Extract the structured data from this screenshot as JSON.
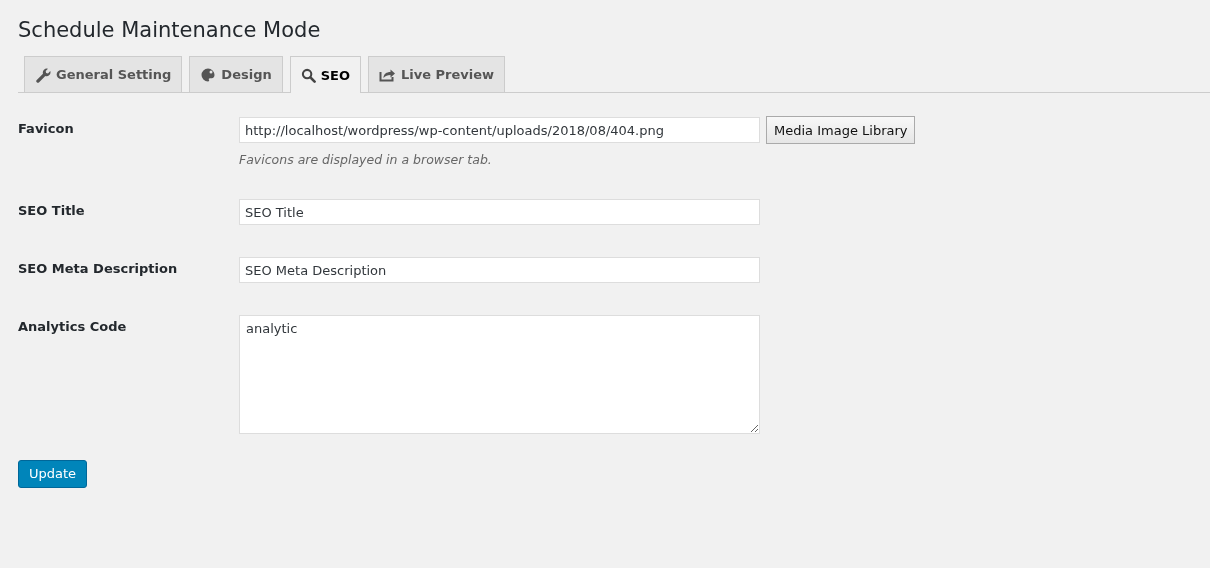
{
  "page": {
    "title": "Schedule Maintenance Mode"
  },
  "tabs": [
    {
      "label": "General Setting",
      "kind": "wrench",
      "selected": false
    },
    {
      "label": "Design",
      "kind": "palette",
      "selected": false
    },
    {
      "label": "SEO",
      "kind": "search",
      "selected": true
    },
    {
      "label": "Live Preview",
      "kind": "share",
      "selected": false
    }
  ],
  "fields": [
    {
      "label": "Favicon",
      "kind": "text",
      "value": "http://localhost/wordpress/wp-content/uploads/2018/08/404.png",
      "button": "Media Image Library",
      "description": "Favicons are displayed in a browser tab."
    },
    {
      "label": "SEO Title",
      "kind": "text",
      "value": "SEO Title"
    },
    {
      "label": "SEO Meta Description",
      "kind": "text",
      "value": "SEO Meta Description"
    },
    {
      "label": "Analytics Code",
      "kind": "textarea",
      "value": "analytic"
    }
  ],
  "submit": {
    "label": "Update"
  }
}
